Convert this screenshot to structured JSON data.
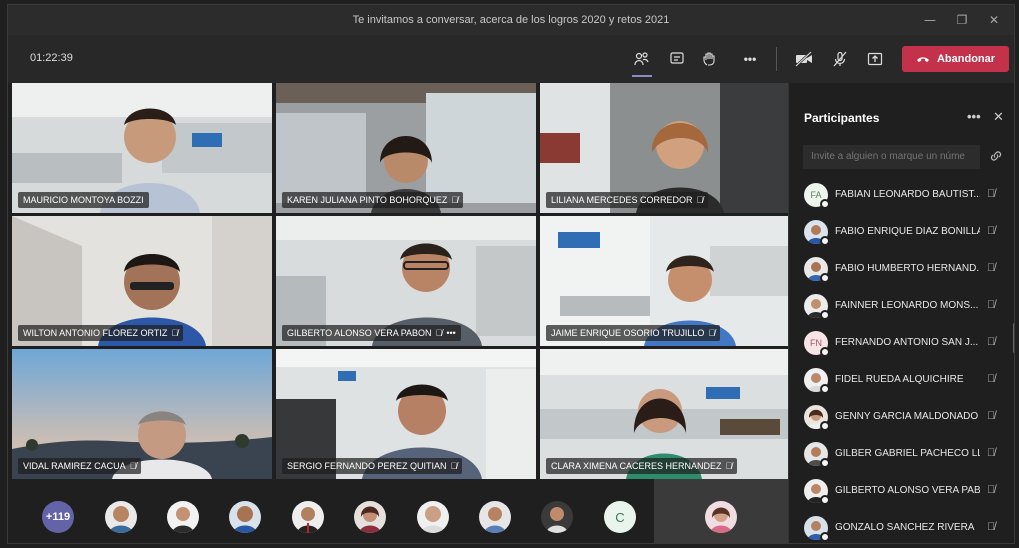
{
  "window": {
    "title": "Te invitamos a conversar, acerca de los logros 2020 y retos 2021",
    "minimize": "—",
    "restore": "❐",
    "close": "✕"
  },
  "toolbar": {
    "timer": "01:22:39",
    "leave_label": "Abandonar",
    "more": "•••"
  },
  "tiles": [
    {
      "name": "MAURICIO MONTOYA BOZZI",
      "mic": "",
      "extra": ""
    },
    {
      "name": "KAREN JULIANA PINTO BOHORQUEZ",
      "mic": "🎙̸",
      "extra": ""
    },
    {
      "name": "LILIANA MERCEDES CORREDOR",
      "mic": "🎙̸",
      "extra": ""
    },
    {
      "name": "WILTON ANTONIO FLOREZ ORTIZ",
      "mic": "🎙̸",
      "extra": ""
    },
    {
      "name": "GILBERTO ALONSO VERA PABON",
      "mic": "🎙̸",
      "extra": "•••"
    },
    {
      "name": "JAIME ENRIQUE OSORIO TRUJILLO",
      "mic": "🎙̸",
      "extra": ""
    },
    {
      "name": "VIDAL RAMIREZ CACUA",
      "mic": "🎙̸",
      "extra": ""
    },
    {
      "name": "SERGIO FERNANDO PEREZ QUITIAN",
      "mic": "🎙̸",
      "extra": ""
    },
    {
      "name": "CLARA XIMENA CACERES HERNANDEZ",
      "mic": "🎙̸",
      "extra": ""
    }
  ],
  "strip": {
    "overflow_count": "+119",
    "letter_avatar": "C"
  },
  "panel": {
    "title": "Participantes",
    "more": "•••",
    "close": "✕",
    "invite_placeholder": "Invite a alguien o marque un núme",
    "participants": [
      {
        "name": "FABIAN LEONARDO BAUTIST...",
        "initials": "FA",
        "mic": "🎙̸"
      },
      {
        "name": "FABIO ENRIQUE DIAZ BONILLA",
        "initials": "",
        "mic": "🎙̸"
      },
      {
        "name": "FABIO HUMBERTO HERNAND...",
        "initials": "",
        "mic": "🎙̸"
      },
      {
        "name": "FAINNER LEONARDO MONS...",
        "initials": "",
        "mic": "🎙̸"
      },
      {
        "name": "FERNANDO ANTONIO SAN J...",
        "initials": "FN",
        "mic": "🎙̸"
      },
      {
        "name": "FIDEL RUEDA ALQUICHIRE",
        "initials": "",
        "mic": "🎙̸"
      },
      {
        "name": "GENNY GARCIA MALDONADO",
        "initials": "",
        "mic": "🎙̸"
      },
      {
        "name": "GILBER GABRIEL PACHECO LL...",
        "initials": "",
        "mic": "🎙̸"
      },
      {
        "name": "GILBERTO ALONSO VERA PAB...",
        "initials": "",
        "mic": "🎙̸"
      },
      {
        "name": "GONZALO SANCHEZ RIVERA",
        "initials": "",
        "mic": "🎙̸"
      }
    ]
  },
  "colors": {
    "accent": "#6264a7",
    "leave": "#c4314b",
    "background": "#1f1f1f"
  }
}
